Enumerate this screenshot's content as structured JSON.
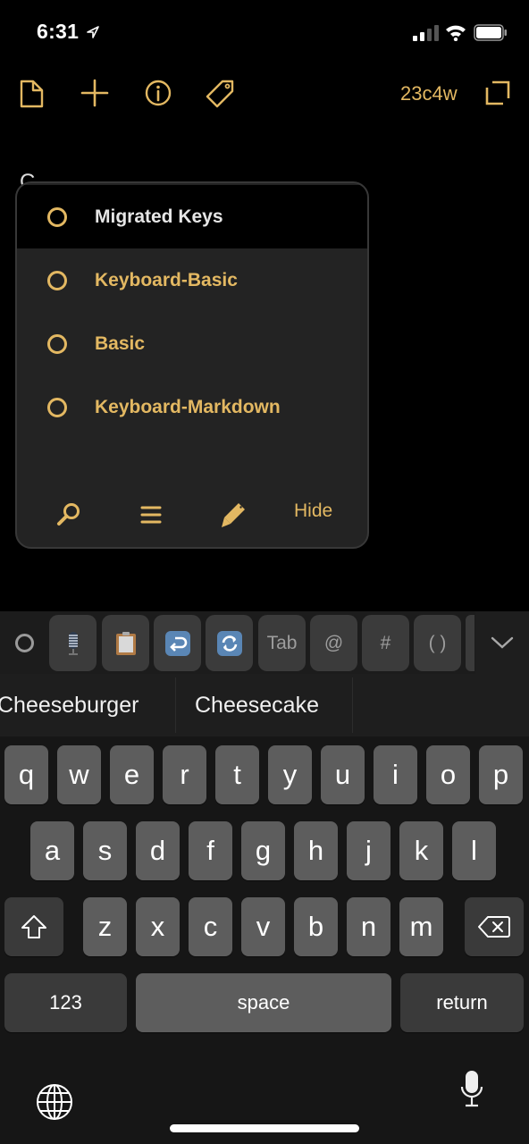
{
  "status_bar": {
    "time": "6:31",
    "icons": [
      "location-arrow-icon",
      "cellular-signal-icon",
      "wifi-icon",
      "battery-icon"
    ]
  },
  "toolbar": {
    "icons": [
      "document-icon",
      "plus-icon",
      "info-icon",
      "tag-icon",
      "expand-icon"
    ],
    "count_label": "23c4w",
    "accent_color": "#e3b862"
  },
  "editor": {
    "typed_text": "C"
  },
  "popup": {
    "items": [
      {
        "label": "Migrated Keys",
        "selected": true
      },
      {
        "label": "Keyboard-Basic",
        "selected": false
      },
      {
        "label": "Basic",
        "selected": false
      },
      {
        "label": "Keyboard-Markdown",
        "selected": false
      }
    ],
    "footer": {
      "icons": [
        "search-icon",
        "list-icon",
        "pencil-icon"
      ],
      "hide_label": "Hide"
    }
  },
  "keyboard": {
    "toolbar": {
      "items": [
        {
          "type": "icon",
          "name": "microphone-emoji-icon"
        },
        {
          "type": "icon",
          "name": "clipboard-emoji-icon"
        },
        {
          "type": "icon",
          "name": "return-arrow-emoji-icon"
        },
        {
          "type": "icon",
          "name": "refresh-emoji-icon"
        },
        {
          "type": "text",
          "label": "Tab"
        },
        {
          "type": "text",
          "label": "@"
        },
        {
          "type": "text",
          "label": "#"
        },
        {
          "type": "text",
          "label": "( )"
        }
      ]
    },
    "suggestions": [
      "Cheeseburger",
      "Cheesecake",
      ""
    ],
    "rows": [
      [
        "q",
        "w",
        "e",
        "r",
        "t",
        "y",
        "u",
        "i",
        "o",
        "p"
      ],
      [
        "a",
        "s",
        "d",
        "f",
        "g",
        "h",
        "j",
        "k",
        "l"
      ],
      [
        "z",
        "x",
        "c",
        "v",
        "b",
        "n",
        "m"
      ]
    ],
    "numbers_label": "123",
    "space_label": "space",
    "return_label": "return"
  }
}
